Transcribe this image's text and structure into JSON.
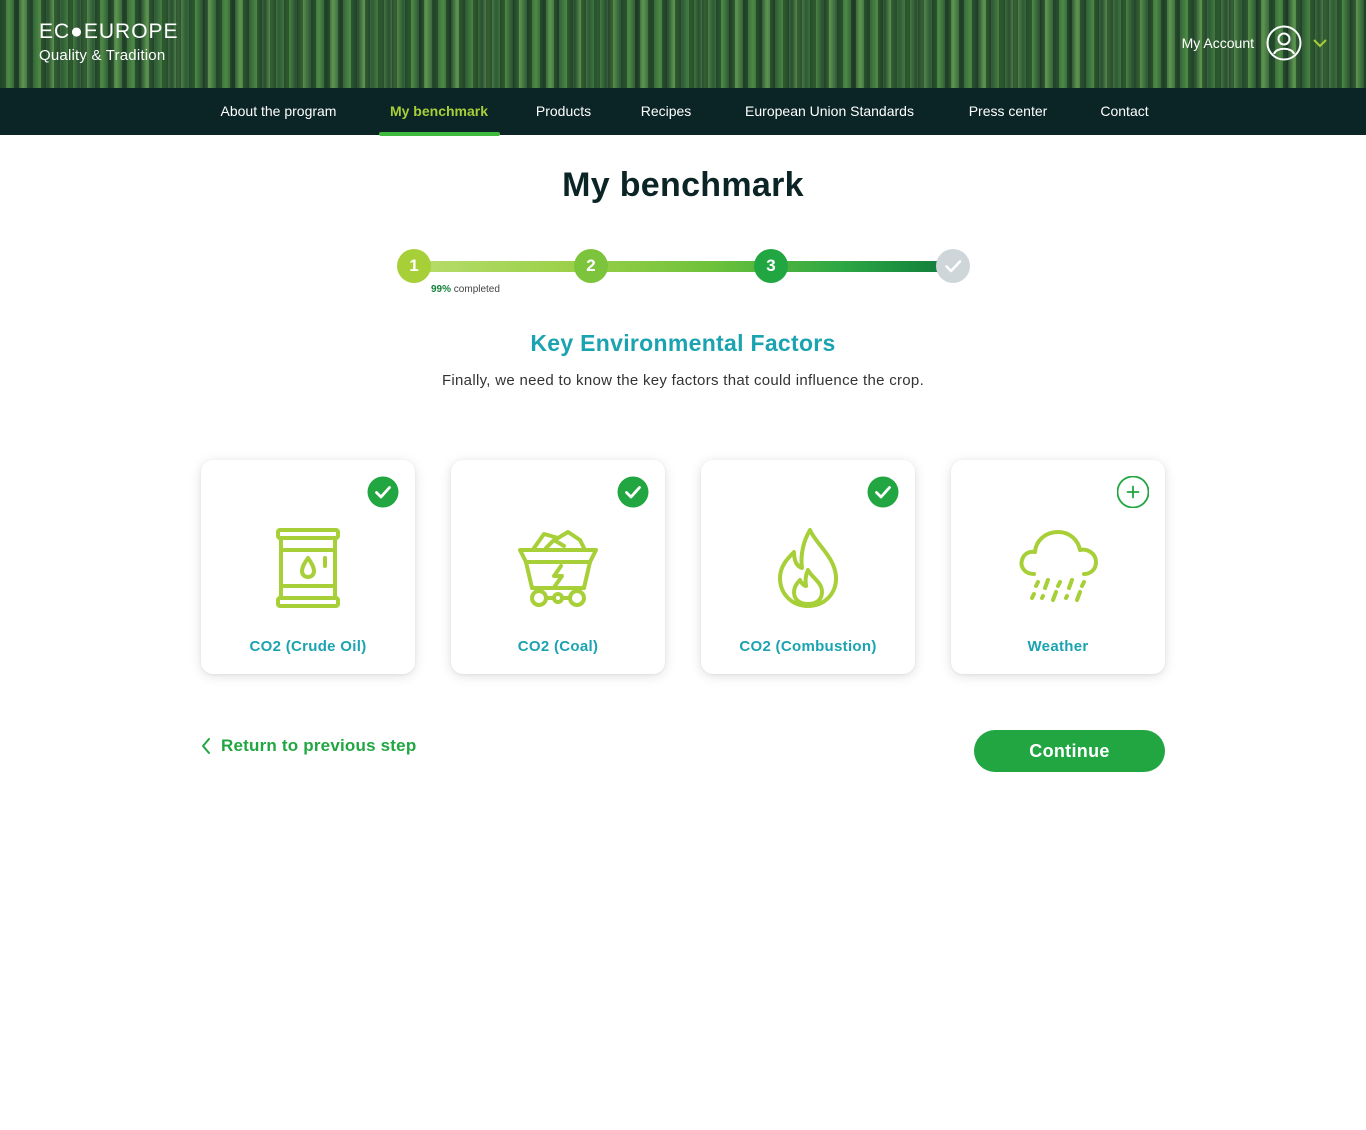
{
  "header": {
    "brand_title": "EC●EUROPE",
    "brand_subtitle": "Quality & Tradition",
    "account_label": "My Account"
  },
  "nav": {
    "items": [
      {
        "label": "About the program"
      },
      {
        "label": "My benchmark"
      },
      {
        "label": "Products"
      },
      {
        "label": "Recipes"
      },
      {
        "label": "European Union Standards"
      },
      {
        "label": "Press center"
      },
      {
        "label": "Contact"
      }
    ],
    "active_index": 1
  },
  "page": {
    "title": "My benchmark"
  },
  "progress": {
    "steps": [
      "1",
      "2",
      "3"
    ],
    "percent_label": "99%",
    "caption": "completed",
    "completion": 0.99
  },
  "section": {
    "title": "Key Environmental Factors",
    "subtitle": "Finally, we need to know the key factors that could influence the crop."
  },
  "factors": [
    {
      "label": "CO2 (Crude Oil)",
      "icon": "oil-barrel-icon",
      "selected": true
    },
    {
      "label": "CO2 (Coal)",
      "icon": "coal-cart-icon",
      "selected": true
    },
    {
      "label": "CO2 (Combustion)",
      "icon": "flame-icon",
      "selected": true
    },
    {
      "label": "Weather",
      "icon": "rain-cloud-icon",
      "selected": false
    }
  ],
  "actions": {
    "back_label": "Return to previous step",
    "continue_label": "Continue"
  },
  "colors": {
    "brand_green": "#21a642",
    "lime": "#a7cf38",
    "teal_text": "#1ba3b2",
    "nav_bg": "#0b2426"
  }
}
